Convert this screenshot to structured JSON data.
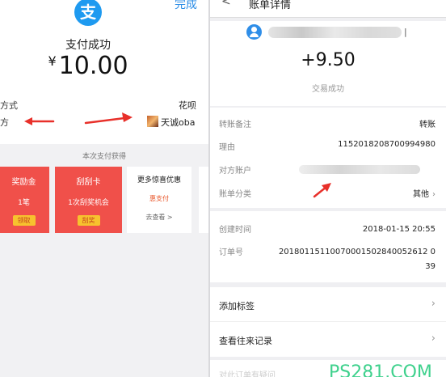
{
  "left": {
    "done_label": "完成",
    "logo_char": "支",
    "pay_title": "支付成功",
    "currency_symbol": "¥",
    "amount": "10.00",
    "method_label": "方式",
    "method_value": "花呗",
    "payee_label": "方",
    "payee_name": "天诚oba",
    "gain_title": "本次支付获得",
    "cards": [
      {
        "title": "奖励金",
        "sub": "1笔",
        "tag": "领取"
      },
      {
        "title": "刮刮卡",
        "sub": "1次刮奖机会",
        "tag": "刮奖"
      }
    ],
    "promo": {
      "title": "更多惊喜优惠",
      "sub": "惠支付",
      "link": "去查看 >"
    }
  },
  "right": {
    "header_title": "账单详情",
    "tail_mark": "|",
    "amount": "+9.50",
    "status": "交易成功",
    "rows": [
      {
        "label": "转账备注",
        "value": "转账"
      },
      {
        "label": "理由",
        "value": "1152018208700994980"
      },
      {
        "label": "对方账户",
        "value": ""
      },
      {
        "label": "账单分类",
        "value": "其他"
      }
    ],
    "created_label": "创建时间",
    "created_value": "2018-01-15 20:55",
    "order_label": "订单号",
    "order_value_line1": "20180115110070001502840052612 0",
    "order_value_line2": "39",
    "actions": [
      {
        "label": "添加标签"
      },
      {
        "label": "查看往来记录"
      }
    ],
    "bottom_text": "对此订单有疑问"
  },
  "watermark": "PS281.COM",
  "colors": {
    "accent_blue": "#1e9af0",
    "card_red": "#f0504a",
    "tag_yellow": "#f7c22e",
    "arrow_red": "#e8302a",
    "watermark_green": "#3fd18d"
  }
}
